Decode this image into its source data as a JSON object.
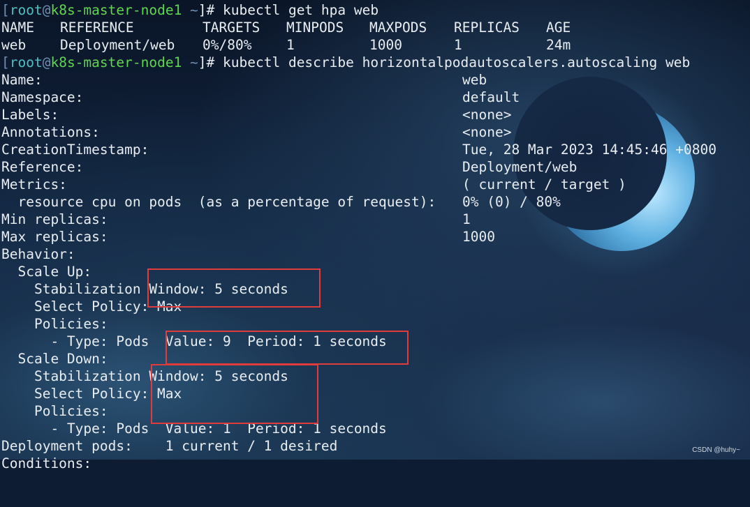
{
  "prompt": {
    "open": "[",
    "user": "root",
    "at": "@",
    "host": "k8s-master-node1",
    "dir": " ~",
    "close": "]# "
  },
  "commands": {
    "get_hpa": "kubectl get hpa web",
    "describe_hpa": "kubectl describe horizontalpodautoscalers.autoscaling web"
  },
  "hpa_table": {
    "headers": [
      "NAME",
      "REFERENCE",
      "TARGETS",
      "MINPODS",
      "MAXPODS",
      "REPLICAS",
      "AGE"
    ],
    "row": [
      "web",
      "Deployment/web",
      "0%/80%",
      "1",
      "1000",
      "1",
      "24m"
    ]
  },
  "describe": {
    "name_label": "Name:",
    "name_value": "web",
    "namespace_label": "Namespace:",
    "namespace_value": "default",
    "labels_label": "Labels:",
    "labels_value": "<none>",
    "annotations_label": "Annotations:",
    "annotations_value": "<none>",
    "created_label": "CreationTimestamp:",
    "created_value": "Tue, 28 Mar 2023 14:45:46 +0800",
    "reference_label": "Reference:",
    "reference_value": "Deployment/web",
    "metrics_label": "Metrics:",
    "metrics_value": "( current / target )",
    "metric_resource_label": "  resource cpu on pods  (as a percentage of request):",
    "metric_resource_value": "0% (0) / 80%",
    "min_replicas_label": "Min replicas:",
    "min_replicas_value": "1",
    "max_replicas_label": "Max replicas:",
    "max_replicas_value": "1000",
    "behavior_label": "Behavior:",
    "scale_up_label": "  Scale Up:",
    "scale_up_stab": "    Stabilization Window: 5 seconds",
    "scale_up_select": "    Select Policy: Max",
    "scale_up_policies": "    Policies:",
    "scale_up_policy": "      - Type: Pods  Value: 9  Period: 1 seconds",
    "scale_down_label": "  Scale Down:",
    "scale_down_stab": "    Stabilization Window: 5 seconds",
    "scale_down_select": "    Select Policy: Max",
    "scale_down_policies": "    Policies:",
    "scale_down_policy": "      - Type: Pods  Value: 1  Period: 1 seconds",
    "deployment_pods": "Deployment pods:    1 current / 1 desired",
    "conditions": "Conditions:"
  },
  "watermark": "CSDN @huhy~",
  "colors": {
    "highlight": "#e23b3b",
    "user": "#4ec0c0",
    "host": "#5fd64f",
    "text": "#e8edf2"
  }
}
